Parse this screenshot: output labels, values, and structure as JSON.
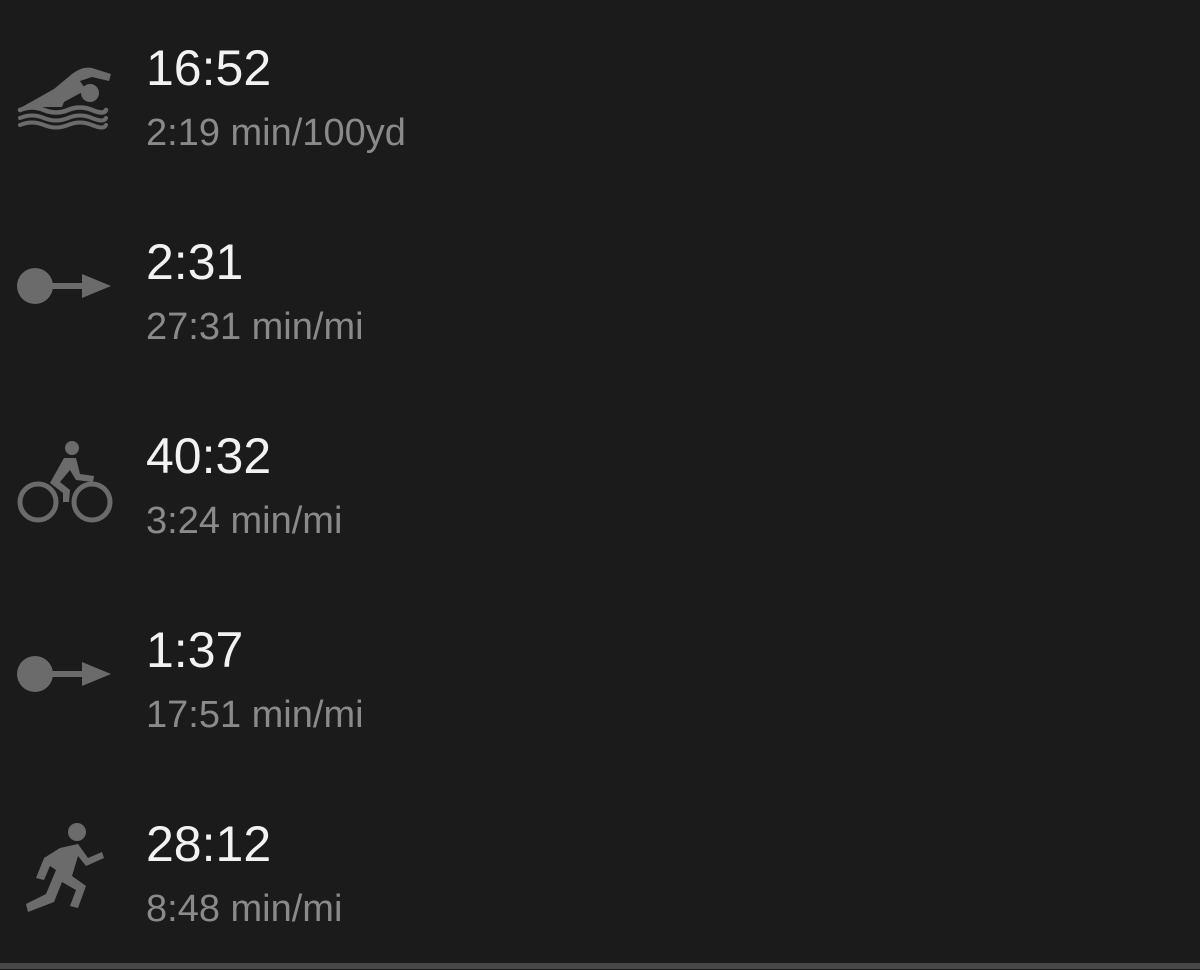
{
  "colors": {
    "background": "#1b1b1b",
    "time_text": "#f2f2f2",
    "pace_text": "#8a8a8a",
    "icon": "#6b6b6b",
    "bottom_bar": "#474747"
  },
  "segments": [
    {
      "icon": "swim-icon",
      "time": "16:52",
      "pace": "2:19 min/100yd"
    },
    {
      "icon": "transition-icon",
      "time": "2:31",
      "pace": "27:31 min/mi"
    },
    {
      "icon": "bike-icon",
      "time": "40:32",
      "pace": "3:24 min/mi"
    },
    {
      "icon": "transition-icon",
      "time": "1:37",
      "pace": "17:51 min/mi"
    },
    {
      "icon": "run-icon",
      "time": "28:12",
      "pace": "8:48 min/mi"
    }
  ]
}
